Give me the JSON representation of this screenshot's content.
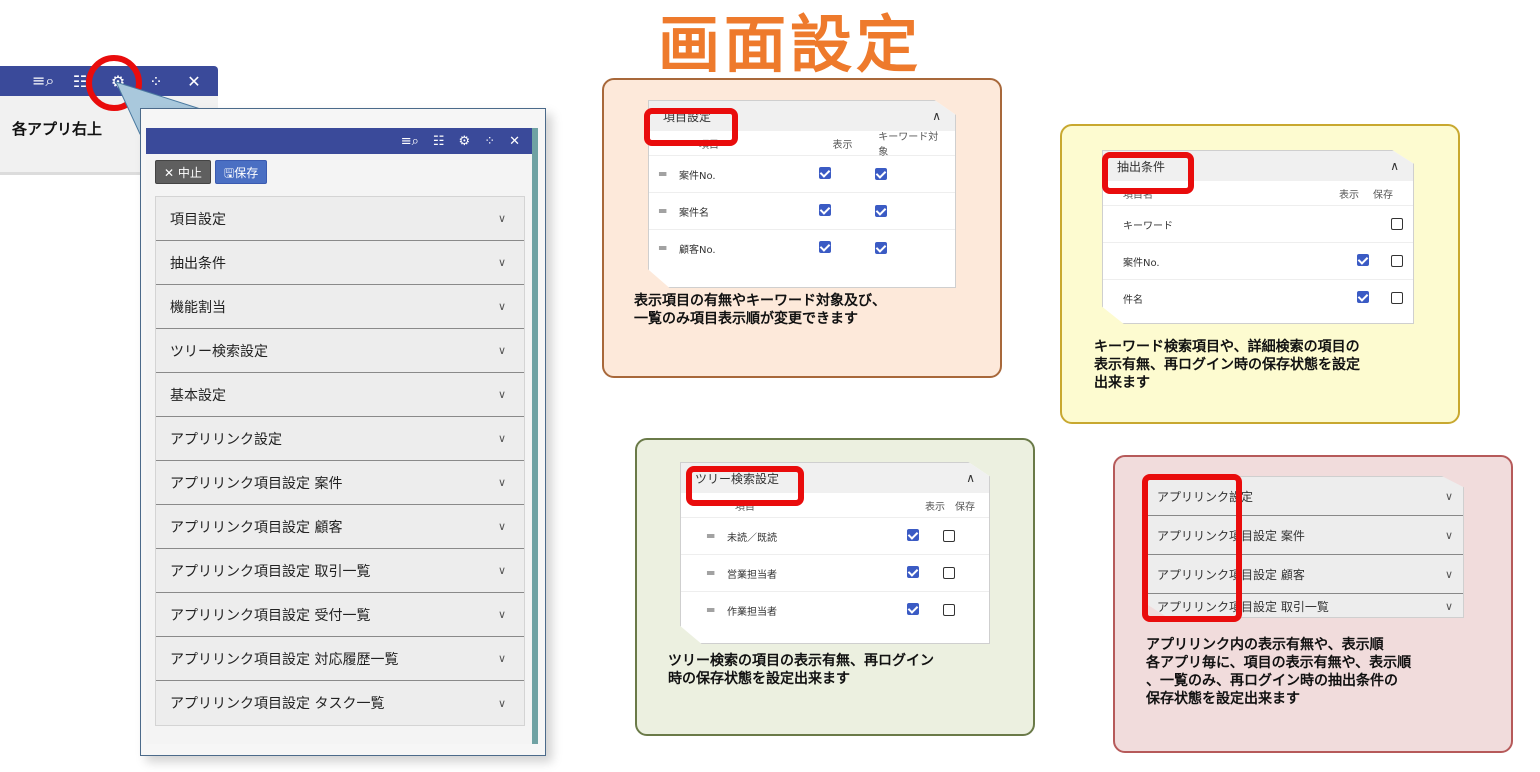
{
  "title": "画面設定",
  "toolbar_icons": [
    "list-search-icon",
    "grid-icon",
    "gear-icon",
    "collapse-icon",
    "close-icon"
  ],
  "callout_label": "各アプリ右上",
  "panel": {
    "cancel_label": "中止",
    "save_label": "保存",
    "menu_items": [
      "項目設定",
      "抽出条件",
      "機能割当",
      "ツリー検索設定",
      "基本設定",
      "アプリリンク設定",
      "アプリリンク項目設定 案件",
      "アプリリンク項目設定 顧客",
      "アプリリンク項目設定 取引一覧",
      "アプリリンク項目設定 受付一覧",
      "アプリリンク項目設定 対応履歴一覧",
      "アプリリンク項目設定 タスク一覧"
    ]
  },
  "card1": {
    "header": "項目設定",
    "col1": "項目",
    "col2": "表示",
    "col3": "キーワード対象",
    "rows": [
      {
        "name": "案件No.",
        "show": true,
        "keyword": true
      },
      {
        "name": "案件名",
        "show": true,
        "keyword": true
      },
      {
        "name": "顧客No.",
        "show": true,
        "keyword": true
      }
    ],
    "desc1": "表示項目の有無やキーワード対象及び、",
    "desc2": "一覧のみ項目表示順が変更できます"
  },
  "card2": {
    "header": "抽出条件",
    "col1": "項目名",
    "col2": "表示",
    "col3": "保存",
    "rows": [
      {
        "name": "キーワード",
        "show": null,
        "save": false
      },
      {
        "name": "案件No.",
        "show": true,
        "save": false
      },
      {
        "name": "件名",
        "show": true,
        "save": false
      }
    ],
    "desc1": "キーワード検索項目や、詳細検索の項目の",
    "desc2": "表示有無、再ログイン時の保存状態を設定",
    "desc3": "出来ます"
  },
  "card3": {
    "header": "ツリー検索設定",
    "col1": "項目",
    "col2": "表示",
    "col3": "保存",
    "rows": [
      {
        "name": "未読／既読",
        "show": true,
        "save": false
      },
      {
        "name": "営業担当者",
        "show": true,
        "save": false
      },
      {
        "name": "作業担当者",
        "show": true,
        "save": false
      }
    ],
    "desc1": "ツリー検索の項目の表示有無、再ログイン",
    "desc2": "時の保存状態を設定出来ます"
  },
  "card4": {
    "rows": [
      "アプリリンク設定",
      "アプリリンク項目設定 案件",
      "アプリリンク項目設定 顧客",
      "アプリリンク項目設定 取引一覧"
    ],
    "desc1": "アプリリンク内の表示有無や、表示順",
    "desc2": "各アプリ毎に、項目の表示有無や、表示順",
    "desc3": "、一覧のみ、再ログイン時の抽出条件の",
    "desc4": "保存状態を設定出来ます"
  }
}
